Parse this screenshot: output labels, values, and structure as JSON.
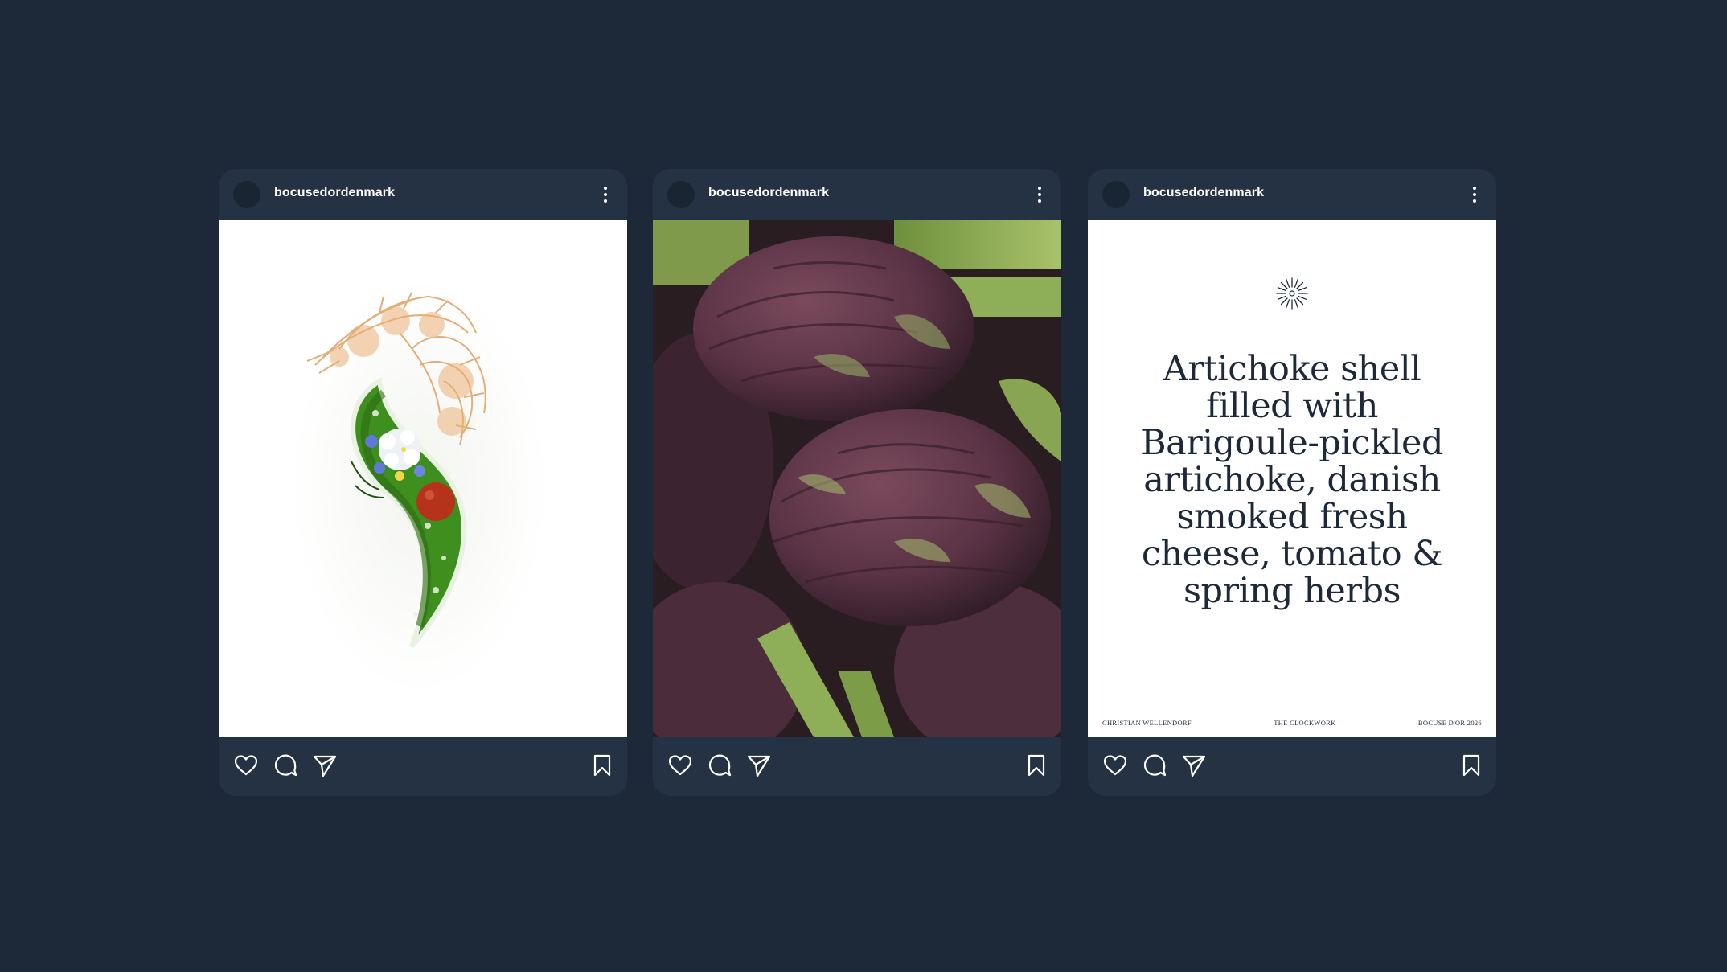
{
  "posts": [
    {
      "username": "bocusedordenmark",
      "media": "plated-dish-photo",
      "actions": {
        "like": "heart-icon",
        "comment": "comment-icon",
        "share": "send-icon",
        "save": "bookmark-icon"
      }
    },
    {
      "username": "bocusedordenmark",
      "media": "artichokes-photo",
      "actions": {
        "like": "heart-icon",
        "comment": "comment-icon",
        "share": "send-icon",
        "save": "bookmark-icon"
      }
    },
    {
      "username": "bocusedordenmark",
      "media": "text-card",
      "card": {
        "title": "Artichoke shell filled with Barigoule-pickled artichoke, danish smoked fresh cheese, tomato & spring herbs",
        "footer_left": "CHRISTIAN WELLENDORF",
        "footer_center": "THE CLOCKWORK",
        "footer_right": "BOCUSE D'OR 2026"
      },
      "actions": {
        "like": "heart-icon",
        "comment": "comment-icon",
        "share": "send-icon",
        "save": "bookmark-icon"
      }
    }
  ],
  "colors": {
    "background": "#1d2939",
    "card": "#243244",
    "avatar": "#1a2534",
    "text_dark": "#1d2939",
    "icon": "#ffffff"
  }
}
